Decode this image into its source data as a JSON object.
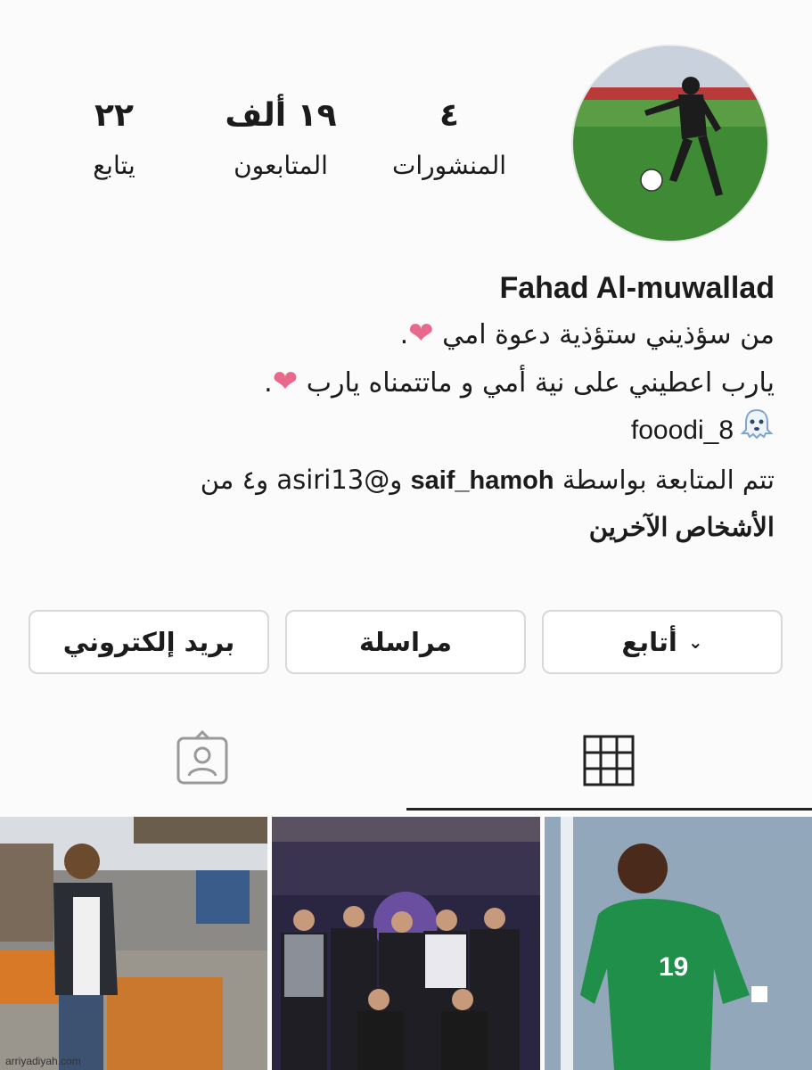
{
  "stats": [
    {
      "value": "٤",
      "label": "المنشورات"
    },
    {
      "value": "١٩ ألف",
      "label": "المتابعون"
    },
    {
      "value": "٢٢",
      "label": "يتابع"
    }
  ],
  "profile": {
    "name": "Fahad Al-muwallad",
    "bio_line_1": "من سؤذيني ستؤذية دعوة امي",
    "bio_line_2": "يارب اعطيني  على نية أمي و ماتتمناه يارب",
    "heart": "❤",
    "period": ".",
    "link_text": "fooodi_8",
    "followed_by_prefix": "تتم المتابعة بواسطة",
    "followed_by_user1": "saif_hamoh",
    "followed_by_mid": "و@asiri13 و٤ من",
    "followed_by_suffix": "الأشخاص الآخرين"
  },
  "actions": {
    "follow": "أتابع",
    "message": "مراسلة",
    "email": "بريد إلكتروني"
  },
  "tabs": {
    "grid": "grid-icon",
    "tagged": "tagged-icon"
  },
  "colors": {
    "heart": "#e8698c",
    "border": "#d8d8d8",
    "text": "#1b1b1b"
  },
  "watermark": "arriyadiyah.com"
}
